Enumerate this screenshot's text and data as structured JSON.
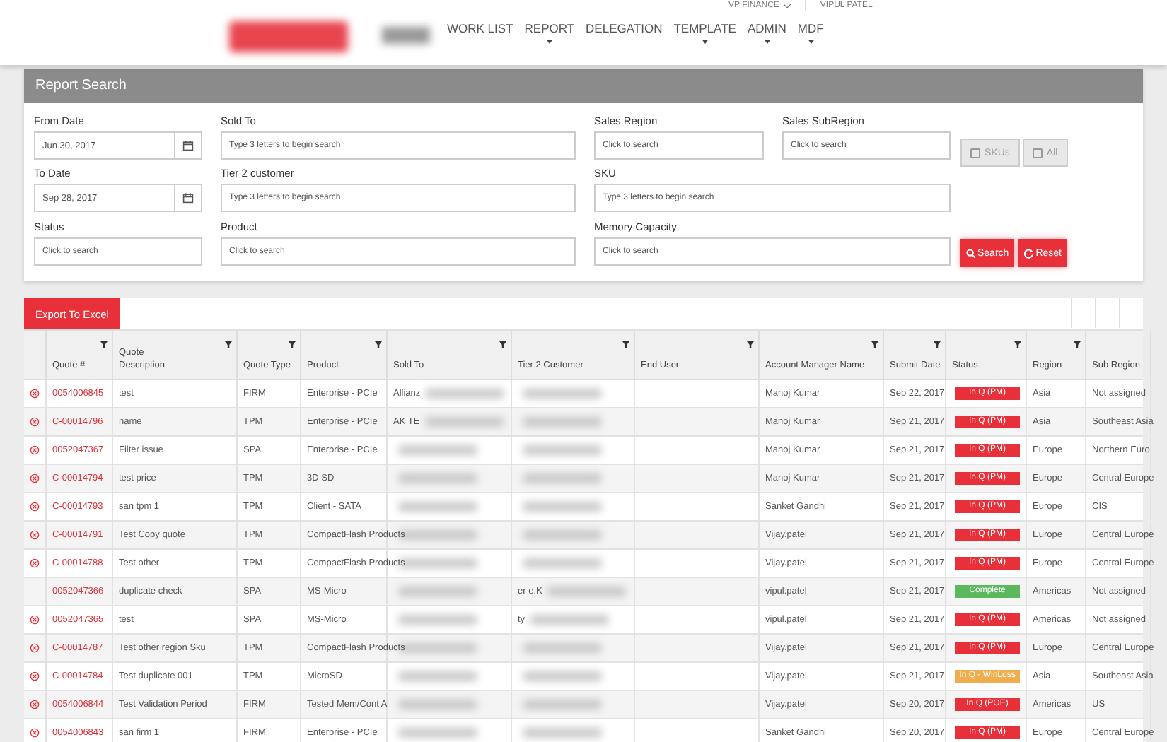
{
  "header": {
    "role": "VP FINANCE",
    "user": "VIPUL PATEL",
    "nav": [
      {
        "label": "WORK LIST",
        "dropdown": false
      },
      {
        "label": "REPORT",
        "dropdown": true
      },
      {
        "label": "DELEGATION",
        "dropdown": false
      },
      {
        "label": "TEMPLATE",
        "dropdown": true
      },
      {
        "label": "ADMIN",
        "dropdown": true
      },
      {
        "label": "MDF",
        "dropdown": true
      }
    ]
  },
  "search_panel": {
    "title": "Report Search",
    "fields": [
      {
        "label": "From Date",
        "value": "Jun 30, 2017",
        "kind": "date"
      },
      {
        "label": "Sold To",
        "placeholder": "Type 3 letters to begin search",
        "kind": "text"
      },
      {
        "label": "Sales Region",
        "placeholder": "Click to search",
        "kind": "text"
      },
      {
        "label": "Sales SubRegion",
        "placeholder": "Click to search",
        "kind": "text"
      },
      {
        "label": "To Date",
        "value": "Sep 28, 2017",
        "kind": "date"
      },
      {
        "label": "Tier 2 customer",
        "placeholder": "Type 3 letters to begin search",
        "kind": "text"
      },
      {
        "label": "SKU",
        "placeholder": "Type 3 letters to begin search",
        "kind": "text"
      },
      {
        "label": "Status",
        "placeholder": "Click to search",
        "kind": "text"
      },
      {
        "label": "Product",
        "placeholder": "Click to search",
        "kind": "text"
      },
      {
        "label": "Memory Capacity",
        "placeholder": "Click to search",
        "kind": "text"
      }
    ],
    "toggles": [
      {
        "label": "SKUs",
        "checked": false
      },
      {
        "label": "All",
        "checked": false
      }
    ],
    "buttons": [
      {
        "label": "Search",
        "kind": "search"
      },
      {
        "label": "Reset",
        "kind": "reset"
      }
    ]
  },
  "table": {
    "export_label": "Export To Excel",
    "columns": [
      {
        "label": "Quote #",
        "filter": true
      },
      {
        "label": "Quote Description",
        "filter": true
      },
      {
        "label": "Quote Type",
        "filter": true
      },
      {
        "label": "Product",
        "filter": true
      },
      {
        "label": "Sold To",
        "filter": true
      },
      {
        "label": "Tier 2 Customer",
        "filter": true
      },
      {
        "label": "End User",
        "filter": true
      },
      {
        "label": "Account Manager Name",
        "filter": true
      },
      {
        "label": "Submit Date",
        "filter": true
      },
      {
        "label": "Status",
        "filter": true
      },
      {
        "label": "Region",
        "filter": true
      },
      {
        "label": "Sub Region",
        "filter": false
      }
    ],
    "rows": [
      {
        "removable": true,
        "quote": "0054006845",
        "description": "test",
        "type": "FIRM",
        "product": "Enterprise - PCIe",
        "sold_to": "Allianz",
        "tier2": "",
        "manager": "Manoj Kumar",
        "date": "Sep 22, 2017",
        "status": {
          "label": "In Q (PM)",
          "color": "#e8303a"
        },
        "region": "Asia",
        "sub_region": "Not assigned"
      },
      {
        "removable": true,
        "quote": "C-00014796",
        "description": "name",
        "type": "TPM",
        "product": "Enterprise - PCIe",
        "sold_to": "AK TE",
        "tier2": "",
        "manager": "Manoj Kumar",
        "date": "Sep 21, 2017",
        "status": {
          "label": "In Q (PM)",
          "color": "#e8303a"
        },
        "region": "Asia",
        "sub_region": "Southeast Asia"
      },
      {
        "removable": true,
        "quote": "0052047367",
        "description": "Filter issue",
        "type": "SPA",
        "product": "Enterprise - PCIe",
        "sold_to": "",
        "tier2": "",
        "manager": "Manoj Kumar",
        "date": "Sep 21, 2017",
        "status": {
          "label": "In Q (PM)",
          "color": "#e8303a"
        },
        "region": "Europe",
        "sub_region": "Northern Euro"
      },
      {
        "removable": true,
        "quote": "C-00014794",
        "description": "test price",
        "type": "TPM",
        "product": "3D SD",
        "sold_to": "",
        "tier2": "",
        "manager": "Manoj Kumar",
        "date": "Sep 21, 2017",
        "status": {
          "label": "In Q (PM)",
          "color": "#e8303a"
        },
        "region": "Europe",
        "sub_region": "Central Europe"
      },
      {
        "removable": true,
        "quote": "C-00014793",
        "description": "san tpm 1",
        "type": "TPM",
        "product": "Client - SATA",
        "sold_to": "",
        "tier2": "",
        "manager": "Sanket Gandhi",
        "date": "Sep 21, 2017",
        "status": {
          "label": "In Q (PM)",
          "color": "#e8303a"
        },
        "region": "Europe",
        "sub_region": "CIS"
      },
      {
        "removable": true,
        "quote": "C-00014791",
        "description": "Test Copy quote",
        "type": "TPM",
        "product": "CompactFlash Products",
        "sold_to": "",
        "tier2": "",
        "manager": "Vijay.patel",
        "date": "Sep 21, 2017",
        "status": {
          "label": "In Q (PM)",
          "color": "#e8303a"
        },
        "region": "Europe",
        "sub_region": "Central Europe"
      },
      {
        "removable": true,
        "quote": "C-00014788",
        "description": "Test other",
        "type": "TPM",
        "product": "CompactFlash Products",
        "sold_to": "",
        "tier2": "",
        "manager": "Vijay.patel",
        "date": "Sep 21, 2017",
        "status": {
          "label": "In Q (PM)",
          "color": "#e8303a"
        },
        "region": "Europe",
        "sub_region": "Central Europe"
      },
      {
        "removable": false,
        "quote": "0052047366",
        "description": "duplicate check",
        "type": "SPA",
        "product": "MS-Micro",
        "sold_to": "",
        "tier2": "er e.K",
        "manager": "vipul.patel",
        "date": "Sep 21, 2017",
        "status": {
          "label": "Complete",
          "color": "#5cb85c"
        },
        "region": "Americas",
        "sub_region": "Not assigned"
      },
      {
        "removable": true,
        "quote": "0052047365",
        "description": "test",
        "type": "SPA",
        "product": "MS-Micro",
        "sold_to": "",
        "tier2": "ty",
        "manager": "vipul.patel",
        "date": "Sep 21, 2017",
        "status": {
          "label": "In Q (PM)",
          "color": "#e8303a"
        },
        "region": "Americas",
        "sub_region": "Not assigned"
      },
      {
        "removable": true,
        "quote": "C-00014787",
        "description": "Test other region Sku",
        "type": "TPM",
        "product": "CompactFlash Products",
        "sold_to": "",
        "tier2": "",
        "manager": "Vijay.patel",
        "date": "Sep 21, 2017",
        "status": {
          "label": "In Q (PM)",
          "color": "#e8303a"
        },
        "region": "Europe",
        "sub_region": "Central Europe"
      },
      {
        "removable": true,
        "quote": "C-00014784",
        "description": "Test duplicate 001",
        "type": "TPM",
        "product": "MicroSD",
        "sold_to": "",
        "tier2": "",
        "manager": "Vijay.patel",
        "date": "Sep 21, 2017",
        "status": {
          "label": "In Q - WinLoss",
          "color": "#f0ad4e"
        },
        "region": "Asia",
        "sub_region": "Southeast Asia"
      },
      {
        "removable": true,
        "quote": "0054006844",
        "description": "Test Validation Period",
        "type": "FIRM",
        "product": "Tested Mem/Cont A",
        "sold_to": "",
        "tier2": "",
        "manager": "Vijay.patel",
        "date": "Sep 20, 2017",
        "status": {
          "label": "In Q (POE)",
          "color": "#e8303a"
        },
        "region": "Americas",
        "sub_region": "US"
      },
      {
        "removable": true,
        "quote": "0054006843",
        "description": "san firm 1",
        "type": "FIRM",
        "product": "Enterprise - PCIe",
        "sold_to": "",
        "tier2": "",
        "manager": "Sanket Gandhi",
        "date": "Sep 20, 2017",
        "status": {
          "label": "In Q (PM)",
          "color": "#e8303a"
        },
        "region": "Europe",
        "sub_region": "Central Europe"
      }
    ]
  }
}
